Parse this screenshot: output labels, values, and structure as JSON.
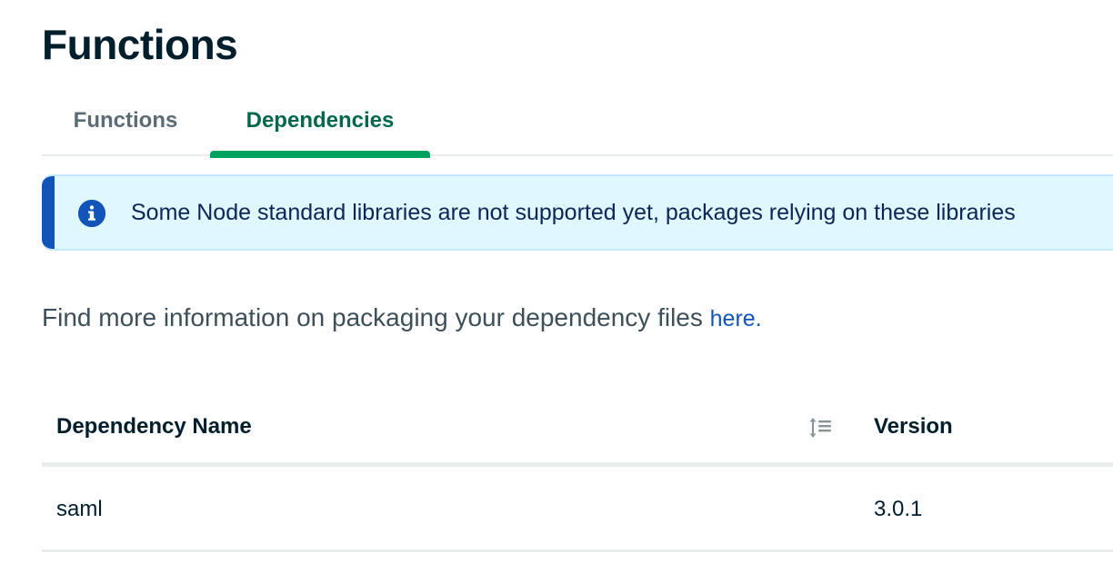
{
  "page": {
    "title": "Functions"
  },
  "tabs": [
    {
      "label": "Functions",
      "active": false
    },
    {
      "label": "Dependencies",
      "active": true
    }
  ],
  "banner": {
    "icon": "info-icon",
    "text": "Some Node standard libraries are not supported yet, packages relying on these libraries"
  },
  "info": {
    "text": "Find more information on packaging your dependency files ",
    "link_label": "here."
  },
  "table": {
    "columns": [
      {
        "label": "Dependency Name",
        "sortable": true,
        "sort_icon": "sort-icon"
      },
      {
        "label": "Version"
      }
    ],
    "rows": [
      {
        "name": "saml",
        "version": "3.0.1"
      }
    ]
  },
  "colors": {
    "active_tab": "#00684a",
    "tab_underline": "#00a35c",
    "banner_bg": "#e1f7ff",
    "banner_accent": "#1254b7",
    "link": "#1254b7"
  }
}
